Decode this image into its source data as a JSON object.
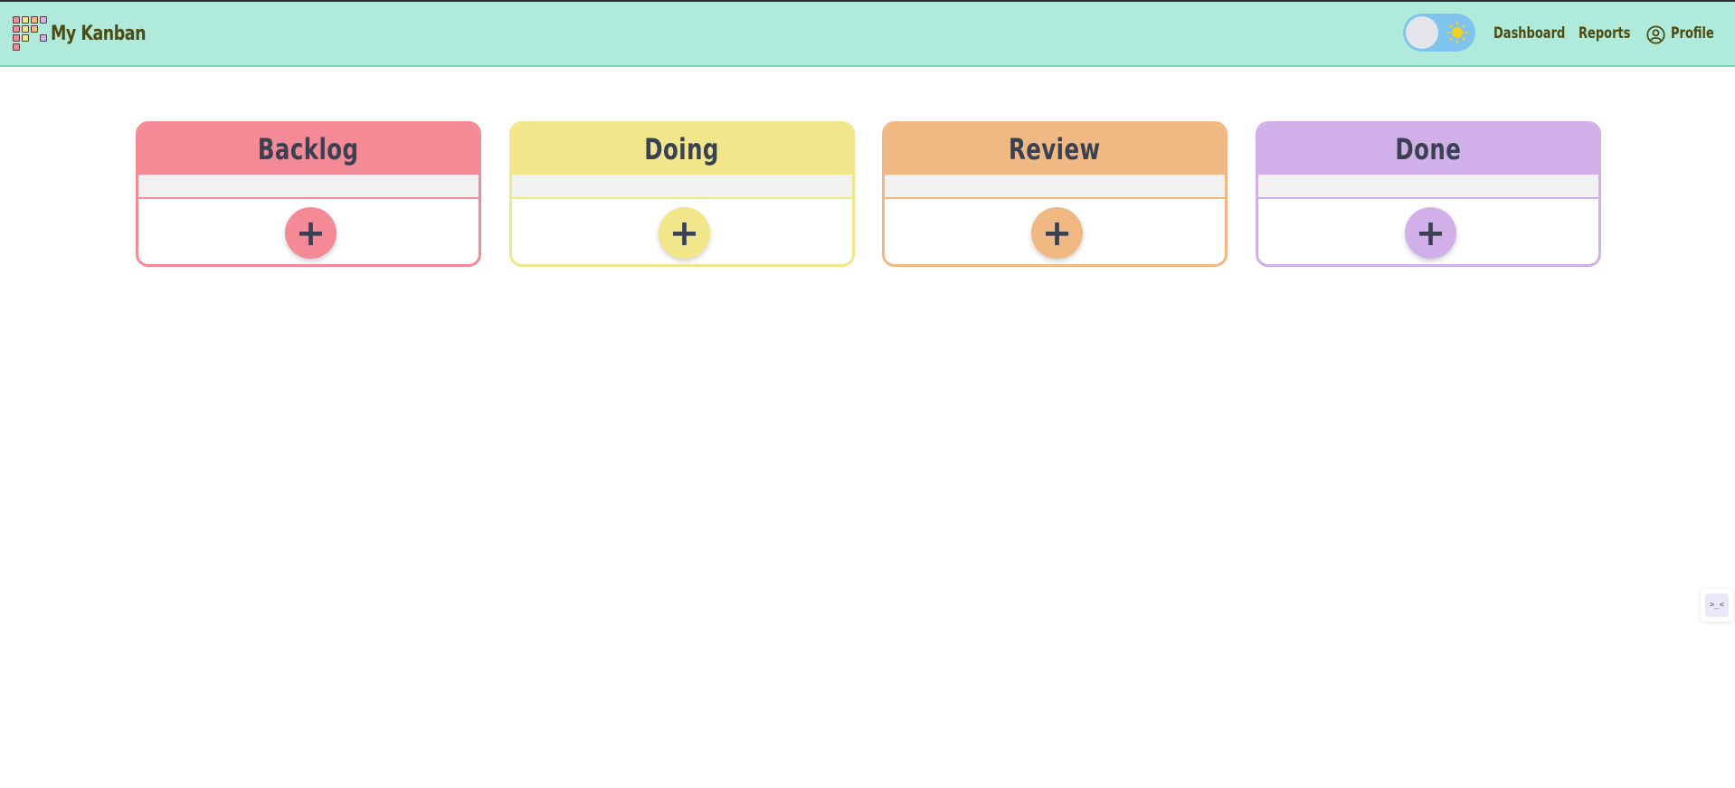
{
  "brand": {
    "name": "My Kanban"
  },
  "nav": {
    "dashboard": "Dashboard",
    "reports": "Reports",
    "profile": "Profile"
  },
  "theme_toggle": {
    "state": "light",
    "icon": "sun-icon"
  },
  "columns": [
    {
      "title": "Backlog",
      "color": "#f48a96",
      "add_label": "+"
    },
    {
      "title": "Doing",
      "color": "#f2e68a",
      "add_label": "+"
    },
    {
      "title": "Review",
      "color": "#f0b984",
      "add_label": "+"
    },
    {
      "title": "Done",
      "color": "#d1b0ea",
      "add_label": "+"
    }
  ],
  "side_widget": {
    "label": ">_<"
  }
}
